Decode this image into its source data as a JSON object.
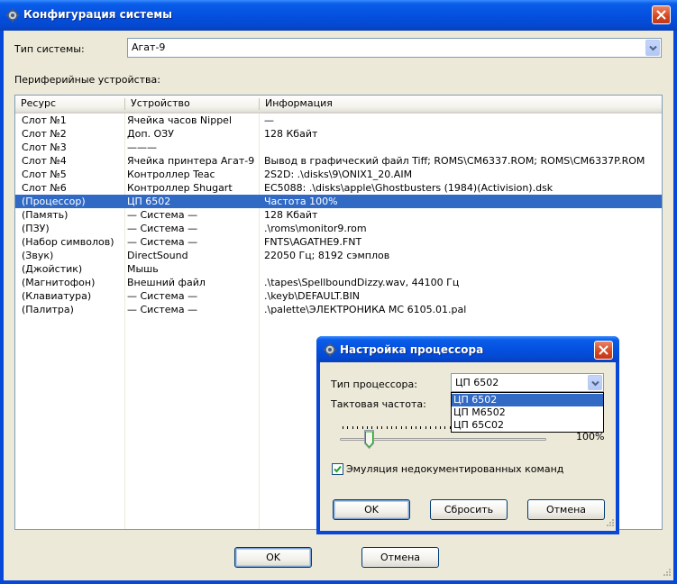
{
  "window": {
    "title": "Конфигурация системы",
    "icon": "app-gear-icon"
  },
  "system": {
    "label": "Тип системы:",
    "value": "Агат-9"
  },
  "peripherals": {
    "label": "Периферийные устройства:",
    "columns": [
      "Ресурс",
      "Устройство",
      "Информация"
    ],
    "rows": [
      {
        "resource": "Слот №1",
        "device": "Ячейка часов Nippel",
        "info": "—"
      },
      {
        "resource": "Слот №2",
        "device": "Доп. ОЗУ",
        "info": "128 Кбайт"
      },
      {
        "resource": "Слот №3",
        "device": "———",
        "info": ""
      },
      {
        "resource": "Слот №4",
        "device": "Ячейка принтера Агат-9",
        "info": "Вывод в графический файл Tiff; ROMS\\CM6337.ROM; ROMS\\CM6337P.ROM"
      },
      {
        "resource": "Слот №5",
        "device": "Контроллер Teac",
        "info": "2S2D: .\\disks\\9\\ONIX1_20.AIM"
      },
      {
        "resource": "Слот №6",
        "device": "Контроллер Shugart",
        "info": "EC5088: .\\disks\\apple\\Ghostbusters (1984)(Activision).dsk"
      },
      {
        "resource": "(Процессор)",
        "device": "ЦП 6502",
        "info": "Частота 100%",
        "selected": true
      },
      {
        "resource": "(Память)",
        "device": "— Система —",
        "info": "128 Кбайт"
      },
      {
        "resource": "(ПЗУ)",
        "device": "— Система —",
        "info": ".\\roms\\monitor9.rom"
      },
      {
        "resource": "(Набор символов)",
        "device": "— Система —",
        "info": "FNTS\\AGATHE9.FNT"
      },
      {
        "resource": "(Звук)",
        "device": "DirectSound",
        "info": "22050 Гц; 8192 сэмплов"
      },
      {
        "resource": "(Джойстик)",
        "device": "Мышь",
        "info": ""
      },
      {
        "resource": "(Магнитофон)",
        "device": "Внешний файл",
        "info": ".\\tapes\\SpellboundDizzy.wav, 44100 Гц"
      },
      {
        "resource": "(Клавиатура)",
        "device": "— Система —",
        "info": ".\\keyb\\DEFAULT.BIN"
      },
      {
        "resource": "(Палитра)",
        "device": "— Система —",
        "info": ".\\palette\\ЭЛЕКТРОНИКА МС 6105.01.pal"
      }
    ]
  },
  "buttons": {
    "ok": "OK",
    "cancel": "Отмена"
  },
  "cpu_dialog": {
    "title": "Настройка процессора",
    "type_label": "Тип процессора:",
    "type_value": "ЦП 6502",
    "type_options": [
      {
        "label": "ЦП 6502",
        "selected": true
      },
      {
        "label": "ЦП M6502"
      },
      {
        "label": "ЦП 65C02"
      }
    ],
    "freq_label": "Тактовая частота:",
    "freq_value_text": "100%",
    "slider_level": 0.14,
    "undoc_label": "Эмуляция недокументированных команд",
    "undoc_checked": true,
    "ok": "OK",
    "reset": "Сбросить",
    "cancel": "Отмена"
  },
  "colors": {
    "title_blue": "#0550e0",
    "selection": "#316ac5",
    "face": "#ece9d8",
    "close_red": "#d4451e"
  }
}
